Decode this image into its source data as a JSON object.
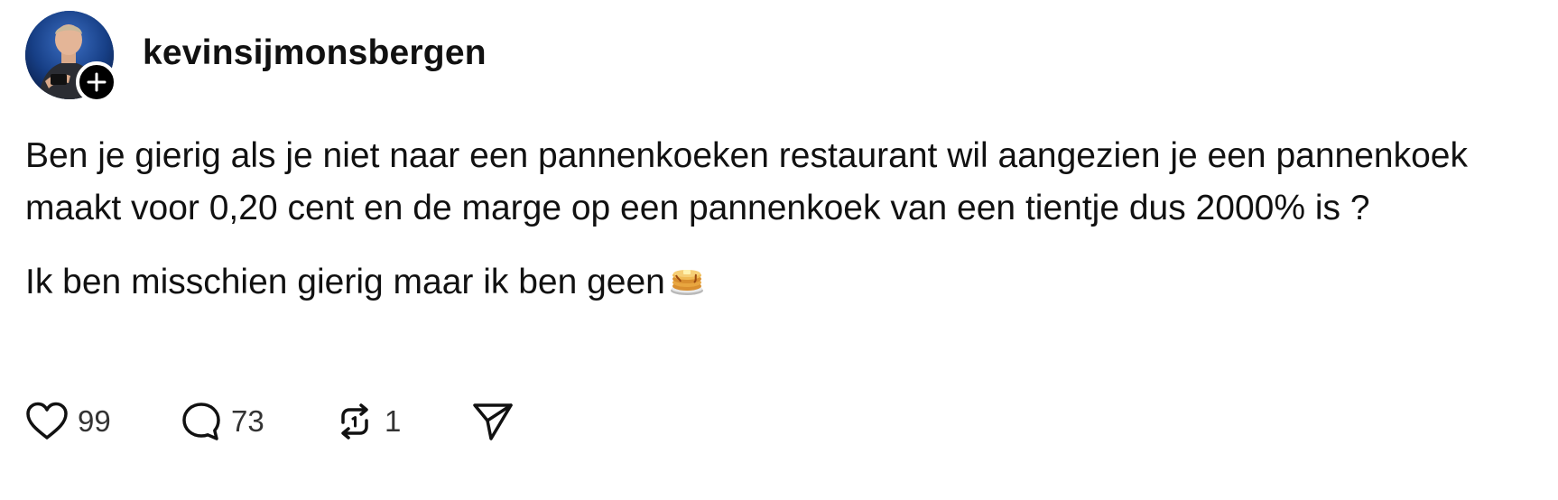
{
  "post": {
    "author": {
      "username": "kevinsijmonsbergen"
    },
    "paragraphs": [
      "Ben je gierig als je niet naar een pannenkoeken restaurant wil aangezien je een pannenkoek maakt voor 0,20 cent en de marge op een pannenkoek van een tientje dus 2000% is ?",
      "Ik ben misschien gierig maar ik ben geen"
    ],
    "emoji": "pancakes-emoji",
    "actions": {
      "likes": "99",
      "replies": "73",
      "reposts": "1"
    }
  },
  "icons": {
    "avatar": "profile-photo",
    "follow": "plus-icon",
    "like": "heart-icon",
    "reply": "comment-icon",
    "repost": "repost-icon",
    "share": "send-icon"
  },
  "colors": {
    "text": "#111111",
    "secondary_text": "#333333",
    "badge": "#000000",
    "background": "#ffffff"
  }
}
